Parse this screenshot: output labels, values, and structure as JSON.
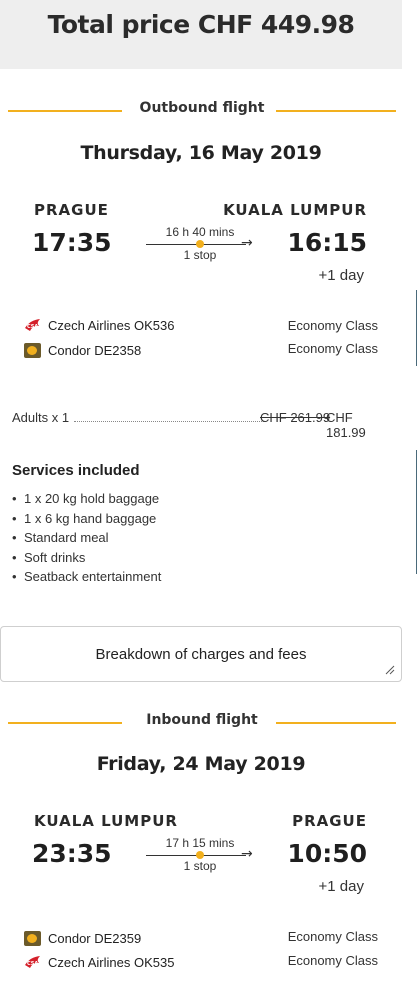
{
  "total": {
    "label": "Total price CHF 449.98"
  },
  "outbound": {
    "section_label": "Outbound flight",
    "date": "Thursday, 16 May 2019",
    "from_city": "PRAGUE",
    "to_city": "KUALA LUMPUR",
    "depart_time": "17:35",
    "arrive_time": "16:15",
    "duration": "16 h 40 mins",
    "stops": "1 stop",
    "plus_day": "+1 day",
    "segments": [
      {
        "airline": "Czech Airlines OK536",
        "cabin": "Economy Class",
        "logo": "csa-logo-icon"
      },
      {
        "airline": "Condor DE2358",
        "cabin": "Economy Class",
        "logo": "condor-logo-icon"
      }
    ]
  },
  "pricing": {
    "adults_label": "Adults x 1",
    "old_price": "CHF 261.99",
    "new_price": "CHF 181.99"
  },
  "services": {
    "title": "Services included",
    "items": [
      "1 x 20 kg hold baggage",
      "1 x 6 kg hand baggage",
      "Standard meal",
      "Soft drinks",
      "Seatback entertainment"
    ]
  },
  "breakdown": {
    "label": "Breakdown of charges and fees"
  },
  "inbound": {
    "section_label": "Inbound flight",
    "date": "Friday, 24 May 2019",
    "from_city": "KUALA LUMPUR",
    "to_city": "PRAGUE",
    "depart_time": "23:35",
    "arrive_time": "10:50",
    "duration": "17 h 15 mins",
    "stops": "1 stop",
    "plus_day": "+1 day",
    "segments": [
      {
        "airline": "Condor DE2359",
        "cabin": "Economy Class",
        "logo": "condor-logo-icon"
      },
      {
        "airline": "Czech Airlines OK535",
        "cabin": "Economy Class",
        "logo": "csa-logo-icon"
      }
    ]
  },
  "colors": {
    "accent": "#f2b01e",
    "header_bg": "#eeeeee"
  }
}
